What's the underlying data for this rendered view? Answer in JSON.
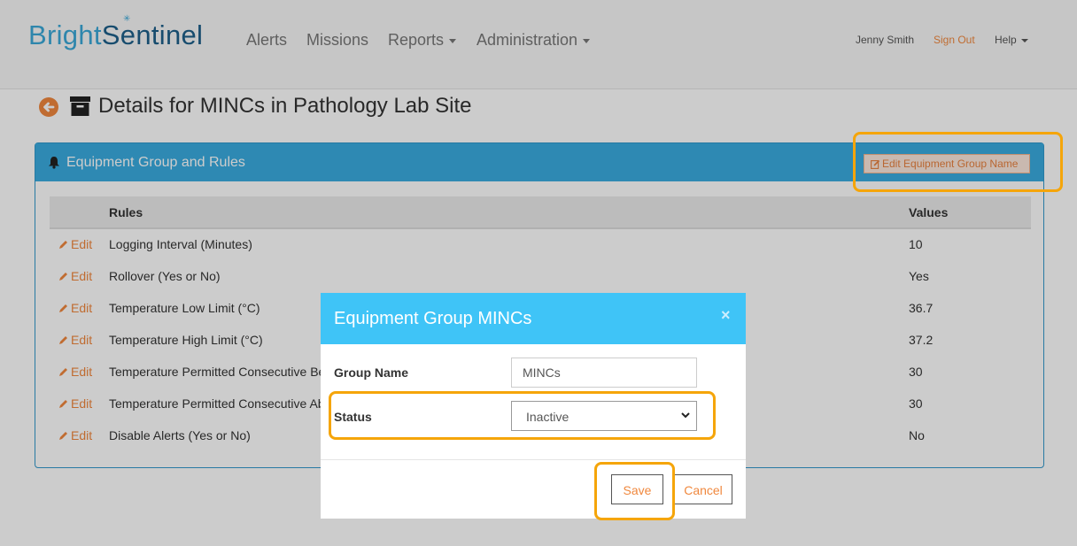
{
  "brand": {
    "part1": "Bright",
    "part2": "Sentinel"
  },
  "nav": {
    "items": [
      {
        "label": "Alerts"
      },
      {
        "label": "Missions"
      },
      {
        "label": "Reports"
      },
      {
        "label": "Administration"
      }
    ],
    "user_name": "Jenny Smith",
    "sign_out": "Sign Out",
    "help": "Help"
  },
  "page": {
    "title": "Details for MINCs in Pathology Lab Site"
  },
  "panel": {
    "title": "Equipment Group and Rules",
    "edit_button": "Edit Equipment Group Name",
    "columns": {
      "rules": "Rules",
      "values": "Values"
    },
    "edit_label": "Edit",
    "rows": [
      {
        "rule": "Logging Interval (Minutes)",
        "value": "10"
      },
      {
        "rule": "Rollover (Yes or No)",
        "value": "Yes"
      },
      {
        "rule": "Temperature Low Limit (°C)",
        "value": "36.7"
      },
      {
        "rule": "Temperature High Limit (°C)",
        "value": "37.2"
      },
      {
        "rule": "Temperature Permitted Consecutive Be",
        "value": "30"
      },
      {
        "rule": "Temperature Permitted Consecutive Ab",
        "value": "30"
      },
      {
        "rule": "Disable Alerts (Yes or No)",
        "value": "No"
      }
    ]
  },
  "modal": {
    "title": "Equipment Group MINCs",
    "close": "×",
    "group_name_label": "Group Name",
    "group_name_value": "MINCs",
    "status_label": "Status",
    "status_value": "Inactive",
    "save": "Save",
    "cancel": "Cancel"
  },
  "colors": {
    "accent": "#f0883e",
    "panel_header": "#3aace0",
    "modal_header": "#3fc4f7",
    "highlight": "#f5a50a"
  }
}
